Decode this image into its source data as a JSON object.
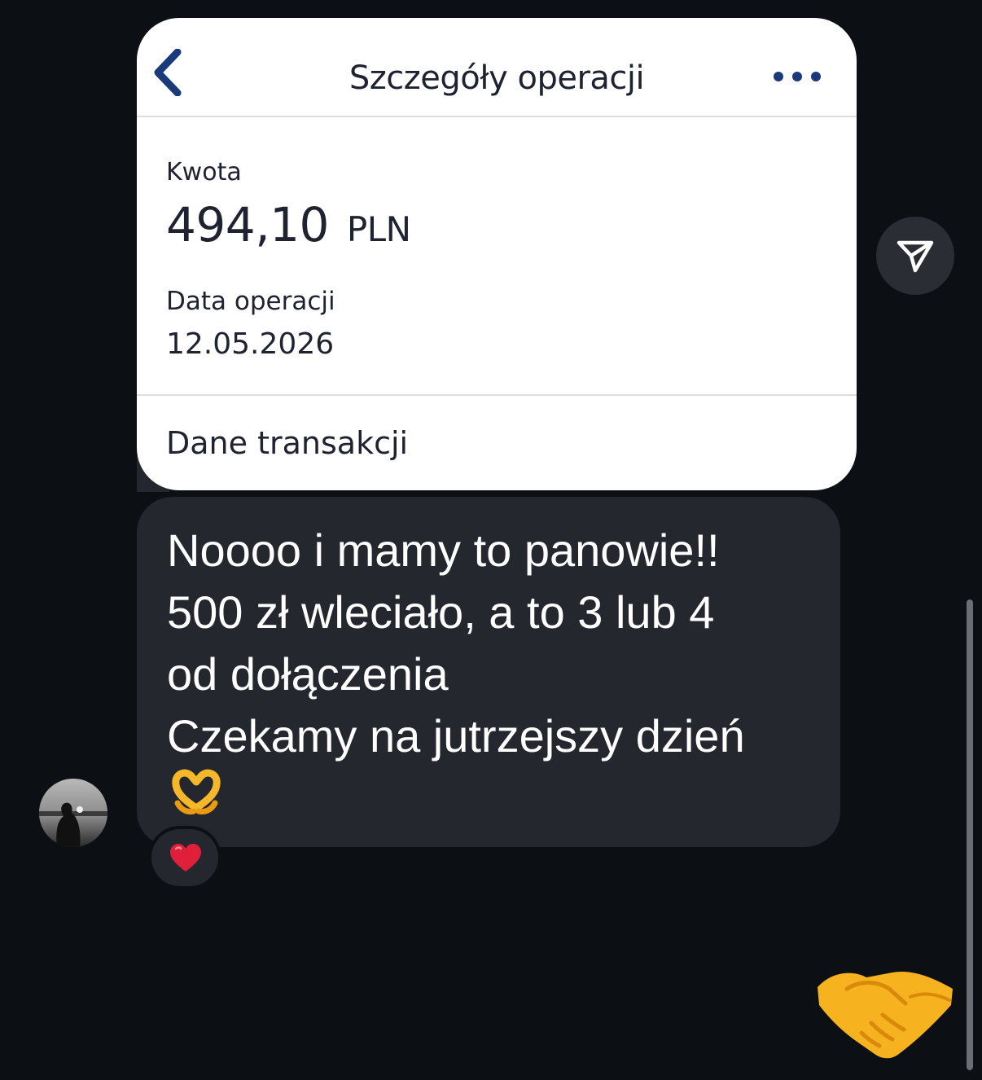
{
  "card": {
    "title": "Szczegóły operacji",
    "amount_label": "Kwota",
    "amount_value": "494,10",
    "amount_currency": "PLN",
    "date_label": "Data operacji",
    "date_value": "12.05.2026",
    "section_label": "Dane transakcji"
  },
  "message": {
    "text": "Noooo i mamy to panowie!!\n500 zł wleciało, a to 3 lub 4\nod dołączenia\nCzekamy na jutrzejszy dzień",
    "emoji": "heart-hands"
  },
  "reaction": {
    "emoji": "red-heart"
  },
  "icons": {
    "back": "chevron-left-icon",
    "more": "ellipsis-icon",
    "send": "send-icon",
    "sticker": "handshake-emoji"
  },
  "colors": {
    "background": "#0c0f14",
    "bubble": "#24272e",
    "card": "#ffffff",
    "accent_blue": "#1a3a7a"
  }
}
